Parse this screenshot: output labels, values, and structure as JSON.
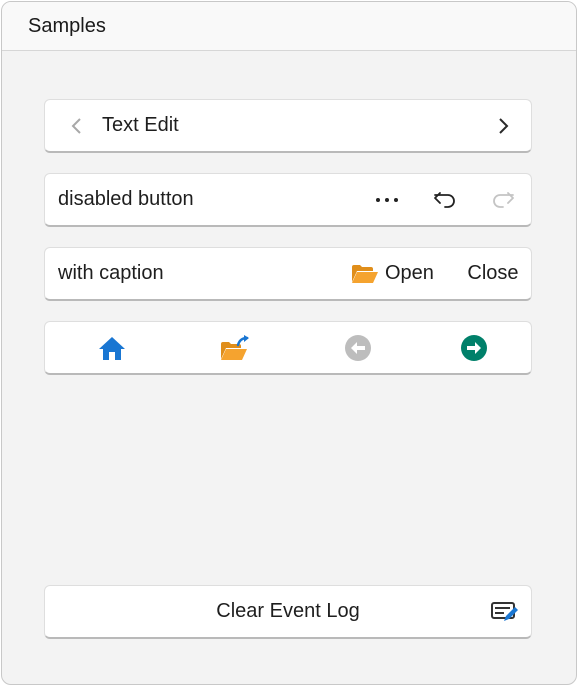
{
  "window": {
    "title": "Samples"
  },
  "nav_row": {
    "label": "Text Edit",
    "prev_icon": "chevron-left-icon",
    "next_icon": "chevron-right-icon"
  },
  "disabled_row": {
    "label": "disabled button",
    "more_icon": "more-icon",
    "undo_icon": "undo-icon",
    "redo_icon": "redo-icon"
  },
  "caption_row": {
    "label": "with caption",
    "open_label": "Open",
    "close_label": "Close",
    "open_icon": "folder-open-icon"
  },
  "icon_row": {
    "icons": [
      "home-icon",
      "folder-share-icon",
      "arrow-left-circle-icon",
      "arrow-right-circle-icon"
    ]
  },
  "bottom": {
    "clear_label": "Clear Event Log",
    "clear_icon": "edit-log-icon"
  },
  "colors": {
    "accent_blue": "#1976d2",
    "folder_orange": "#f5a32f",
    "teal": "#00806a",
    "disabled_gray": "#bdbdbd"
  }
}
